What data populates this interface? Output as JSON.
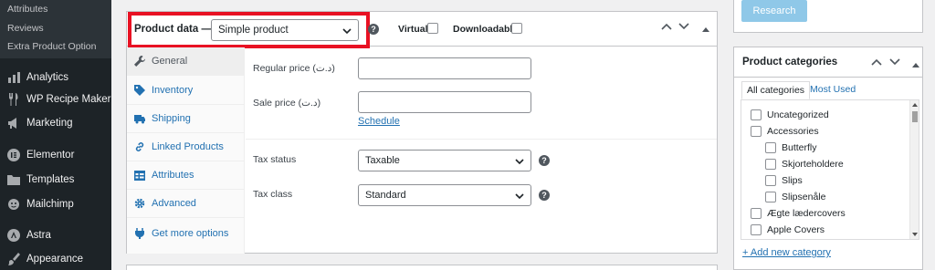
{
  "sidebar": {
    "submenu": [
      "Attributes",
      "Reviews",
      "Extra Product Option"
    ],
    "items": [
      {
        "label": "Analytics",
        "icon": "bar-chart-icon"
      },
      {
        "label": "WP Recipe Maker",
        "icon": "utensils-icon"
      },
      {
        "label": "Marketing",
        "icon": "megaphone-icon"
      },
      {
        "label": "Elementor",
        "icon": "elementor-icon"
      },
      {
        "label": "Templates",
        "icon": "folder-icon"
      },
      {
        "label": "Mailchimp",
        "icon": "mailchimp-icon"
      },
      {
        "label": "Astra",
        "icon": "astra-icon"
      },
      {
        "label": "Appearance",
        "icon": "brush-icon"
      }
    ]
  },
  "product_data": {
    "title": "Product data —",
    "type_value": "Simple product",
    "virtual_label": "Virtual:",
    "downloadable_label": "Downloadable:",
    "tabs": [
      {
        "label": "General",
        "icon": "wrench-icon",
        "active": true
      },
      {
        "label": "Inventory",
        "icon": "tag-icon",
        "active": false
      },
      {
        "label": "Shipping",
        "icon": "truck-icon",
        "active": false
      },
      {
        "label": "Linked Products",
        "icon": "link-icon",
        "active": false
      },
      {
        "label": "Attributes",
        "icon": "table-icon",
        "active": false
      },
      {
        "label": "Advanced",
        "icon": "gear-icon",
        "active": false
      },
      {
        "label": "Get more options",
        "icon": "plugin-icon",
        "active": false
      }
    ],
    "fields": {
      "regular_price_label": "Regular price (د.ت)",
      "sale_price_label": "Sale price (د.ت)",
      "schedule_link": "Schedule",
      "tax_status_label": "Tax status",
      "tax_status_value": "Taxable",
      "tax_class_label": "Tax class",
      "tax_class_value": "Standard"
    }
  },
  "right": {
    "research_button": "Research",
    "categories": {
      "title": "Product categories",
      "tabs": [
        "All categories",
        "Most Used"
      ],
      "items": [
        {
          "label": "Uncategorized",
          "level": 0
        },
        {
          "label": "Accessories",
          "level": 0
        },
        {
          "label": "Butterfly",
          "level": 1
        },
        {
          "label": "Skjorteholdere",
          "level": 1
        },
        {
          "label": "Slips",
          "level": 1
        },
        {
          "label": "Slipsenåle",
          "level": 1
        },
        {
          "label": "Ægte lædercovers",
          "level": 0
        },
        {
          "label": "Apple Covers",
          "level": 0
        }
      ],
      "add_new": "+ Add new category"
    }
  },
  "colors": {
    "highlight": "#e81123",
    "link": "#2271b1",
    "sidebar_bg": "#1d2327"
  }
}
